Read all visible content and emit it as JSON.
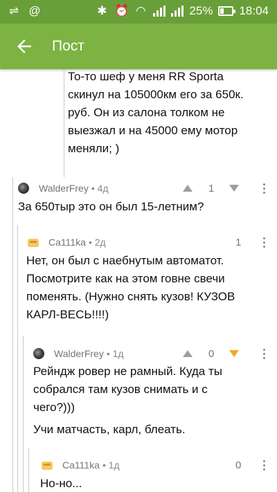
{
  "status_bar": {
    "battery": "25%",
    "time": "18:04"
  },
  "app_bar": {
    "title": "Пост"
  },
  "comments": [
    {
      "lines": [
        "То-то шеф у меня RR Sporta",
        "скинул на 105000км его за 650к.",
        "руб. Он из салона толком не",
        "выезжал и на 45000 ему мотор",
        "меняли; )"
      ]
    },
    {
      "author": "WalderFrey",
      "time": "• 4д",
      "score": "1",
      "lines": [
        "За 650тыр это он был 15-летним?"
      ]
    },
    {
      "author": "Ca111ka",
      "time": "• 2д",
      "score": "1",
      "lines": [
        "Нет, он был с наебнутым автоматот.",
        "Посмотрите как на этом говне свечи",
        "поменять. (Нужно снять кузов! КУЗОВ",
        "КАРЛ-ВЕСЬ!!!!)"
      ]
    },
    {
      "author": "WalderFrey",
      "time": "• 1д",
      "score": "0",
      "lines": [
        "Рейндж ровер не рамный. Куда ты",
        "собрался там кузов снимать и с",
        "чего?)))",
        "Учи матчасть, карл, блеать."
      ]
    },
    {
      "author": "Ca111ka",
      "time": "• 1д",
      "score": "0",
      "lines": [
        "Но-но..."
      ]
    }
  ],
  "colors": {
    "status_bar": "#689f38",
    "app_bar": "#7cb342",
    "downvote_active": "#f5a623"
  }
}
